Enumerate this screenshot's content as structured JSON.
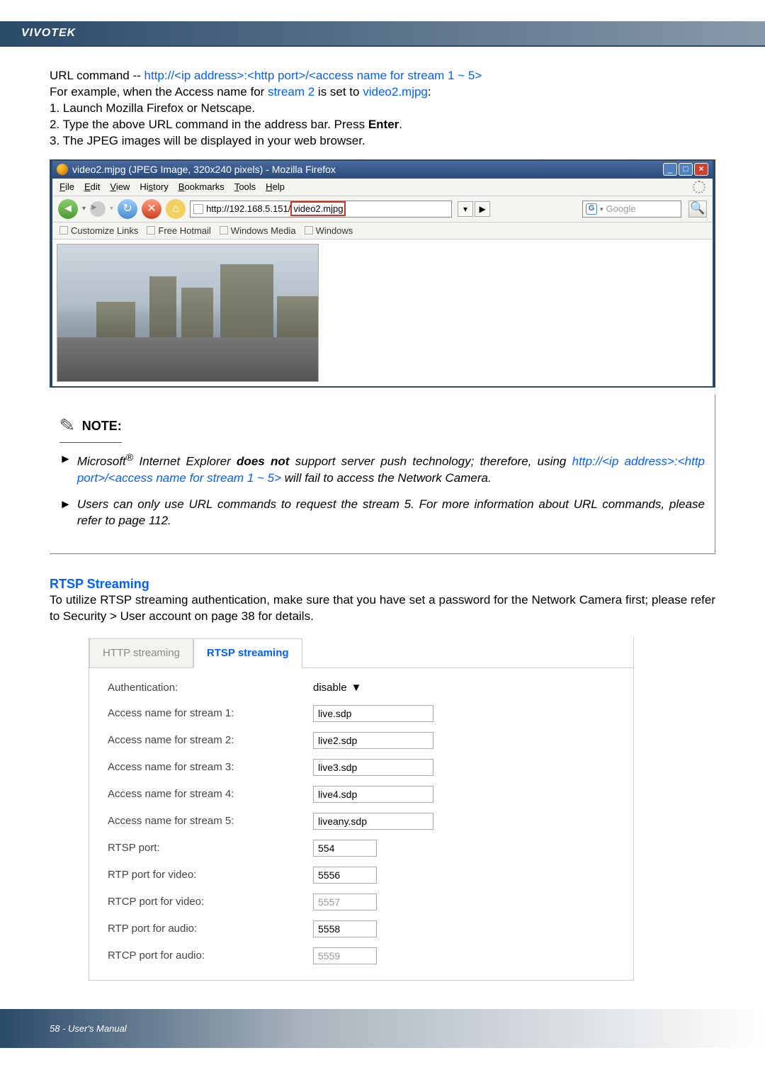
{
  "brand": "VIVOTEK",
  "url_cmd": {
    "label": "URL command -- ",
    "pattern": "http://<ip address>:<http port>/<access name for stream 1 ~ 5>"
  },
  "example": {
    "prefix": "For example, when the Access name for ",
    "stream": "stream 2",
    "mid": " is set to ",
    "file": "video2.mjpg",
    "suffix": ":"
  },
  "steps": {
    "s1": "1. Launch Mozilla Firefox or Netscape.",
    "s2_pre": "2. Type the above URL command in the address bar. Press ",
    "s2_bold": "Enter",
    "s2_post": ".",
    "s3": "3. The JPEG images will be displayed in your web browser."
  },
  "browser": {
    "window_title": "video2.mjpg (JPEG Image, 320x240 pixels) - Mozilla Firefox",
    "menu": {
      "file": "File",
      "edit": "Edit",
      "view": "View",
      "history": "History",
      "bookmarks": "Bookmarks",
      "tools": "Tools",
      "help": "Help"
    },
    "address_prefix": "http://192.168.5.151/",
    "address_hl": "video2.mjpg",
    "search_placeholder": "Google",
    "bookmarks": [
      "Customize Links",
      "Free Hotmail",
      "Windows Media",
      "Windows"
    ]
  },
  "note": {
    "heading": "NOTE:",
    "item1_pre": "Microsoft",
    "item1_reg": "®",
    "item1_mid": " Internet Explorer ",
    "item1_bold": "does not",
    "item1_post": " support server push technology; therefore, using ",
    "item1_url": "http://<ip address>:<http port>/<access name for stream 1 ~ 5>",
    "item1_tail": " will fail to access the Network Camera.",
    "item2": "Users can only use URL commands to request the stream 5. For more information about URL commands, please refer to page 112."
  },
  "rtsp": {
    "heading": "RTSP Streaming",
    "intro": "To utilize RTSP streaming authentication, make sure that you have set a password for the Network Camera first; please refer to Security > User account on page 38 for details.",
    "tabs": {
      "http": "HTTP streaming",
      "rtsp": "RTSP streaming"
    },
    "fields": {
      "auth_label": "Authentication:",
      "auth_value": "disable",
      "s1_label": "Access name for stream 1:",
      "s1_value": "live.sdp",
      "s2_label": "Access name for stream 2:",
      "s2_value": "live2.sdp",
      "s3_label": "Access name for stream 3:",
      "s3_value": "live3.sdp",
      "s4_label": "Access name for stream 4:",
      "s4_value": "live4.sdp",
      "s5_label": "Access name for stream 5:",
      "s5_value": "liveany.sdp",
      "rtsp_port_label": "RTSP port:",
      "rtsp_port_value": "554",
      "rtp_video_label": "RTP port for video:",
      "rtp_video_value": "5556",
      "rtcp_video_label": "RTCP port for video:",
      "rtcp_video_value": "5557",
      "rtp_audio_label": "RTP port for audio:",
      "rtp_audio_value": "5558",
      "rtcp_audio_label": "RTCP port for audio:",
      "rtcp_audio_value": "5559"
    }
  },
  "footer": "58 - User's Manual"
}
